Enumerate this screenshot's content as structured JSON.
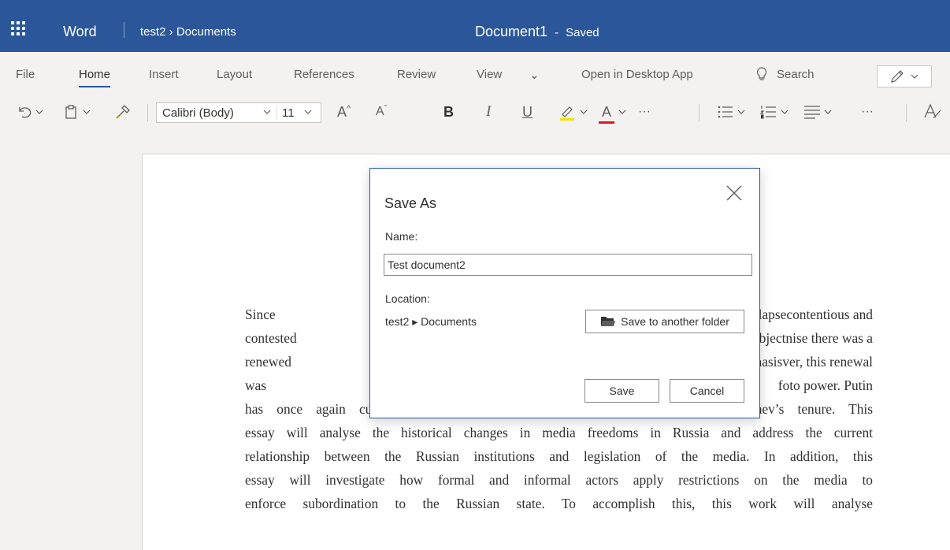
{
  "titlebar": {
    "app_name": "Word",
    "breadcrumb": "test2 › Documents",
    "document_name": "Document1",
    "separator": "-",
    "save_status": "Saved"
  },
  "ribbon": {
    "tabs": [
      {
        "label": "File"
      },
      {
        "label": "Home",
        "active": true
      },
      {
        "label": "Insert"
      },
      {
        "label": "Layout"
      },
      {
        "label": "References"
      },
      {
        "label": "Review"
      },
      {
        "label": "View"
      }
    ],
    "more_tabs_glyph": "⌄",
    "open_desktop": "Open in Desktop App",
    "search_label": "Search",
    "toolbar": {
      "font_name": "Calibri (Body)",
      "font_size": "11",
      "grow_font": "A",
      "shrink_font": "A",
      "bold": "B",
      "italic": "I",
      "underline": "U",
      "font_color_letter": "A",
      "more": "···",
      "highlight_color": "#f2e400",
      "font_color": "#e81123"
    }
  },
  "document": {
    "lines": [
      "Since the collapse",
      "contested subject",
      "renewed emphasis",
      "was short lived fo",
      "has once again curtailed the media liberties that were accepted in Gorbachev’s tenure. This",
      "essay will analyse the historical changes in media freedoms in Russia and address the current",
      "relationship between the Russian institutions and legislation of the media. In addition, this",
      "essay will investigate how formal and informal actors apply restrictions on the media to",
      "enforce subordination to the Russian state. To accomplish this, this work will analyse"
    ],
    "right_fragments": [
      "contentious and",
      "nise there was a",
      "ver, this renewal",
      "to power. Putin"
    ]
  },
  "dialog": {
    "title": "Save As",
    "name_label": "Name:",
    "name_value": "Test document2",
    "location_label": "Location:",
    "location_path": "test2 ▸ Documents",
    "folder_button": "Save to another folder",
    "save_button": "Save",
    "cancel_button": "Cancel"
  },
  "colors": {
    "accent": "#2b579a"
  }
}
